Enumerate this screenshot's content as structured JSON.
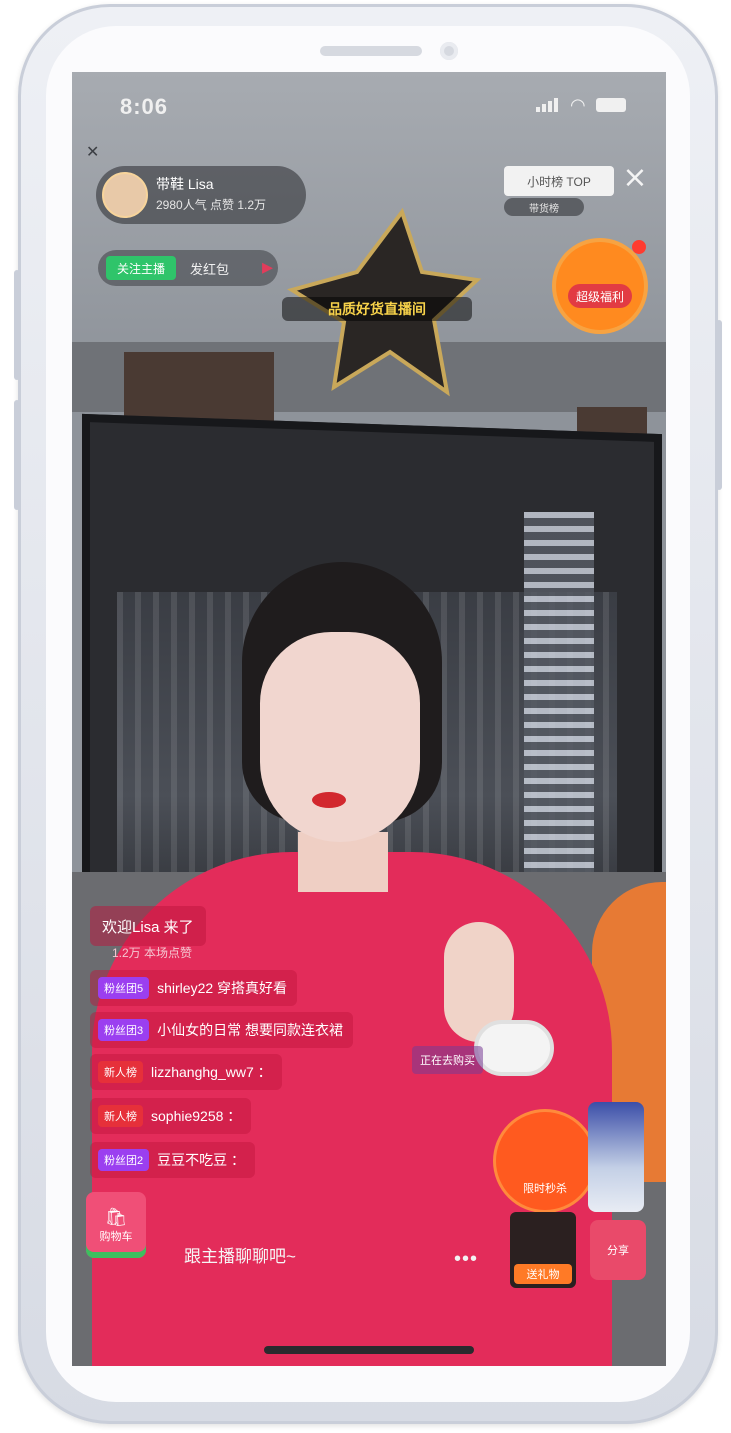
{
  "status_bar": {
    "time": "8:06"
  },
  "host": {
    "name": "带鞋 Lisa",
    "sub": "2980人气 点赞 1.2万"
  },
  "follow": {
    "button": "关注主播",
    "text": "发红包"
  },
  "star_badge": {
    "text": "品质好货直播间"
  },
  "rank": {
    "label": "小时榜 TOP",
    "sub": "带货榜"
  },
  "redbag": {
    "label": "超级福利"
  },
  "chat": {
    "first": "欢迎Lisa 来了",
    "first_sub": "1.2万 本场点赞",
    "messages": [
      {
        "tag": "粉丝团5",
        "tag_color": "purple",
        "text": "shirley22 穿搭真好看"
      },
      {
        "tag": "粉丝团3",
        "tag_color": "purple",
        "text": "小仙女的日常 想要同款连衣裙"
      },
      {
        "tag": "新人榜",
        "tag_color": "red",
        "text": "lizzhanghg_ww7 ："
      },
      {
        "tag": "新人榜",
        "tag_color": "red",
        "text": "sophie9258 ："
      },
      {
        "tag": "粉丝团2",
        "tag_color": "purple",
        "text": "豆豆不吃豆 ："
      }
    ],
    "mini_badge": "正在去购买"
  },
  "bottom": {
    "cart_label": "购物车",
    "comment_placeholder": "跟主播聊聊吧~",
    "more": "•••",
    "promo": "限时秒杀",
    "gift": "送礼物",
    "share": "分享"
  }
}
